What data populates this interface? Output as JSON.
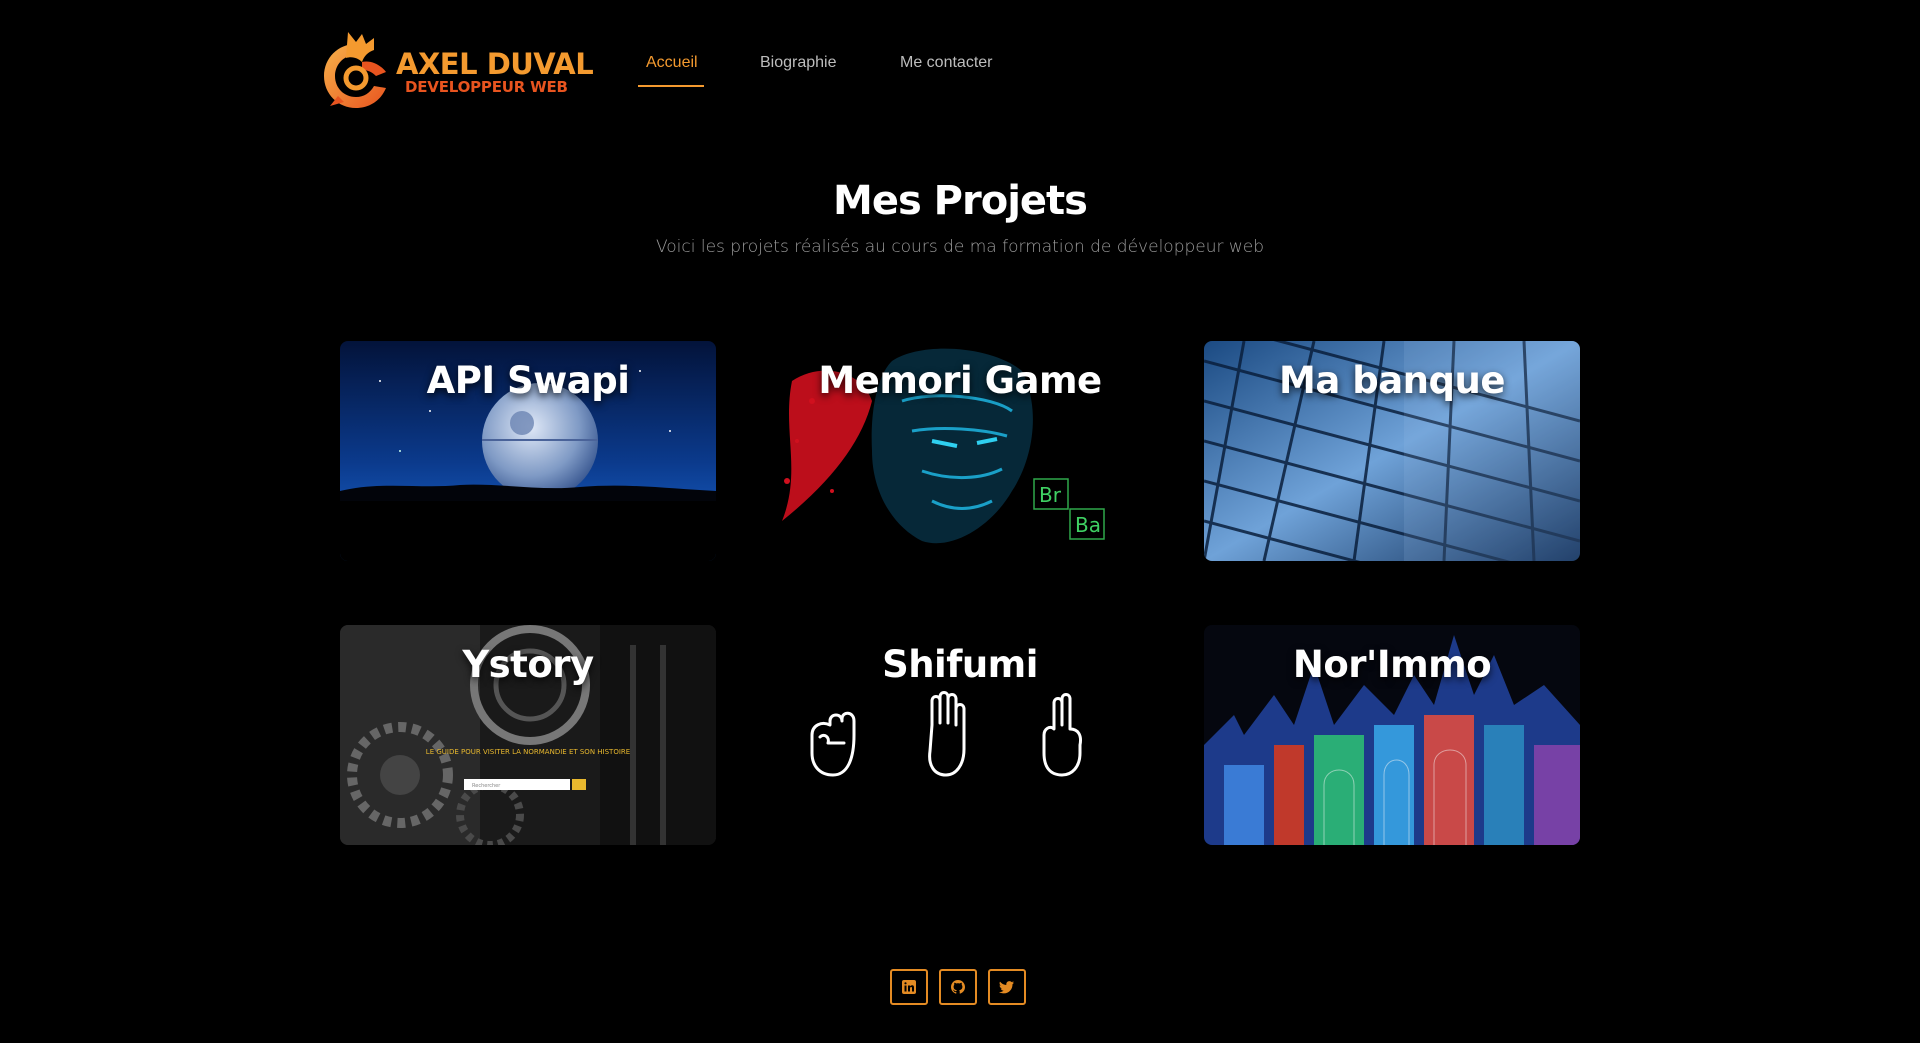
{
  "brand": {
    "name": "AXEL DUVAL",
    "tagline": "DEVELOPPEUR WEB",
    "logo_icon": "rooster-logo-icon"
  },
  "nav": {
    "items": [
      {
        "label": "Accueil",
        "active": true
      },
      {
        "label": "Biographie",
        "active": false
      },
      {
        "label": "Me contacter",
        "active": false
      }
    ]
  },
  "main": {
    "title": "Mes Projets",
    "subtitle": "Voici les projets réalisés au cours de ma formation de développeur web"
  },
  "projects": [
    {
      "title": "API Swapi"
    },
    {
      "title": "Memori Game"
    },
    {
      "title": "Ma banque"
    },
    {
      "title": "Ystory",
      "screenshot_text": "LE GUIDE POUR VISITER LA NORMANDIE ET SON HISTOIRE",
      "search_placeholder": "Rechercher"
    },
    {
      "title": "Shifumi"
    },
    {
      "title": "Nor'Immo"
    }
  ],
  "footer": {
    "social": [
      {
        "icon": "linkedin-icon"
      },
      {
        "icon": "github-icon"
      },
      {
        "icon": "twitter-icon"
      }
    ]
  },
  "colors": {
    "accent": "#f49a2f",
    "accent_dark": "#e8541f",
    "background": "#000000"
  }
}
